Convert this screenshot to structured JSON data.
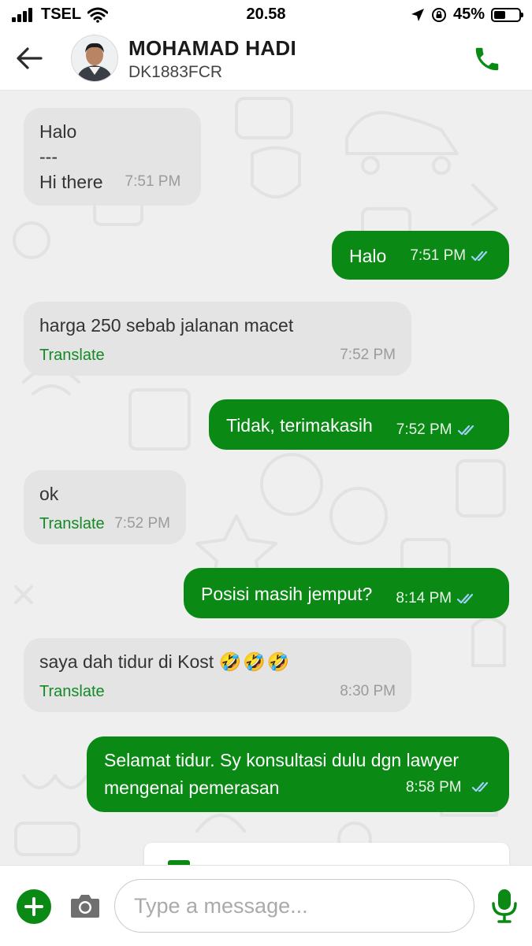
{
  "status_bar": {
    "carrier": "TSEL",
    "time": "20.58",
    "battery_percent": "45%",
    "battery_level": 0.45,
    "icons": [
      "signal-icon",
      "wifi-icon",
      "location-arrow-icon",
      "rotation-lock-icon",
      "battery-icon"
    ]
  },
  "header": {
    "back_icon": "back-arrow-icon",
    "contact_name": "MOHAMAD HADI",
    "plate_number": "DK1883FCR",
    "call_icon": "phone-icon"
  },
  "messages": [
    {
      "direction": "incoming",
      "lines": [
        "Halo",
        "---",
        "Hi there"
      ],
      "time": "7:51 PM"
    },
    {
      "direction": "outgoing",
      "text": "Halo",
      "time": "7:51 PM",
      "status": "read"
    },
    {
      "direction": "incoming",
      "text": "harga 250 sebab jalanan macet",
      "translate": "Translate",
      "time": "7:52 PM"
    },
    {
      "direction": "outgoing",
      "text": "Tidak, terimakasih",
      "time": "7:52 PM",
      "status": "read"
    },
    {
      "direction": "incoming",
      "text": "ok",
      "translate": "Translate",
      "time": "7:52 PM"
    },
    {
      "direction": "outgoing",
      "text": "Posisi masih jemput?",
      "time": "8:14 PM",
      "status": "read"
    },
    {
      "direction": "incoming",
      "text": "saya dah tidur di Kost",
      "emoji": "🤣🤣🤣",
      "translate": "Translate",
      "time": "8:30 PM"
    },
    {
      "direction": "outgoing",
      "lines": [
        "Selamat tidur. Sy konsultasi dulu dgn lawyer",
        "mengenai pemerasan"
      ],
      "time": "8:58 PM",
      "status": "read"
    }
  ],
  "composer": {
    "placeholder": "Type a message...",
    "icons": [
      "plus-icon",
      "camera-icon",
      "microphone-icon"
    ]
  },
  "colors": {
    "brand_green": "#0a8a15",
    "incoming_bubble": "#e4e4e4",
    "chat_background": "#efefef",
    "translate_link": "#138a26",
    "read_ticks": "#9fd0ff"
  }
}
